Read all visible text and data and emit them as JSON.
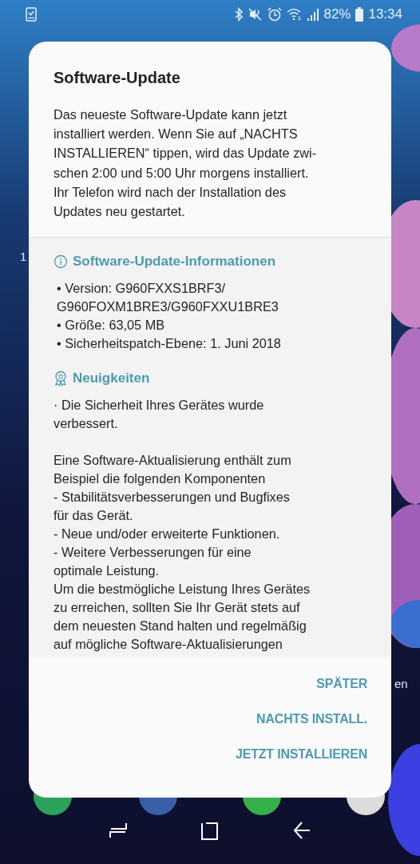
{
  "status_bar": {
    "battery": "82%",
    "time": "13:34"
  },
  "home_labels": {
    "left_edge": "1",
    "right_edge": "en"
  },
  "dialog": {
    "title": "Software-Update",
    "intro": "Das neueste Software-Update kann jetzt\ninstalliert werden. Wenn Sie auf „NACHTS\nINSTALLIEREN“ tippen, wird das Update zwi-\nschen 2:00 und 5:00 Uhr morgens installiert.\nIhr Telefon wird nach der Installation des\nUpdates neu gestartet.",
    "sections": [
      {
        "kind": "info",
        "heading": "Software-Update-Informationen",
        "paragraphs": [
          "• Version: G960FXXS1BRF3/\nG960FOXM1BRE3/G960FXXU1BRE3",
          "• Größe: 63,05 MB",
          "• Sicherheitspatch-Ebene: 1. Juni 2018"
        ]
      },
      {
        "kind": "news",
        "heading": "Neuigkeiten",
        "paragraphs": [
          "· Die Sicherheit Ihres Gerätes wurde\nverbessert.",
          "Eine Software-Aktualisierung enthält zum\nBeispiel die folgenden Komponenten\n - Stabilitätsverbesserungen und Bugfixes\nfür das Gerät.\n - Neue und/oder erweiterte Funktionen.\n - Weitere Verbesserungen für eine\noptimale Leistung.\nUm die bestmögliche Leistung Ihres Gerätes\nzu erreichen, sollten Sie Ihr Gerät stets auf\ndem neuesten Stand halten und regelmäßig\nauf mögliche Software-Aktualisierungen"
        ]
      }
    ],
    "buttons": [
      "SPÄTER",
      "NACHTS INSTALL.",
      "JETZT INSTALLIEREN"
    ]
  }
}
